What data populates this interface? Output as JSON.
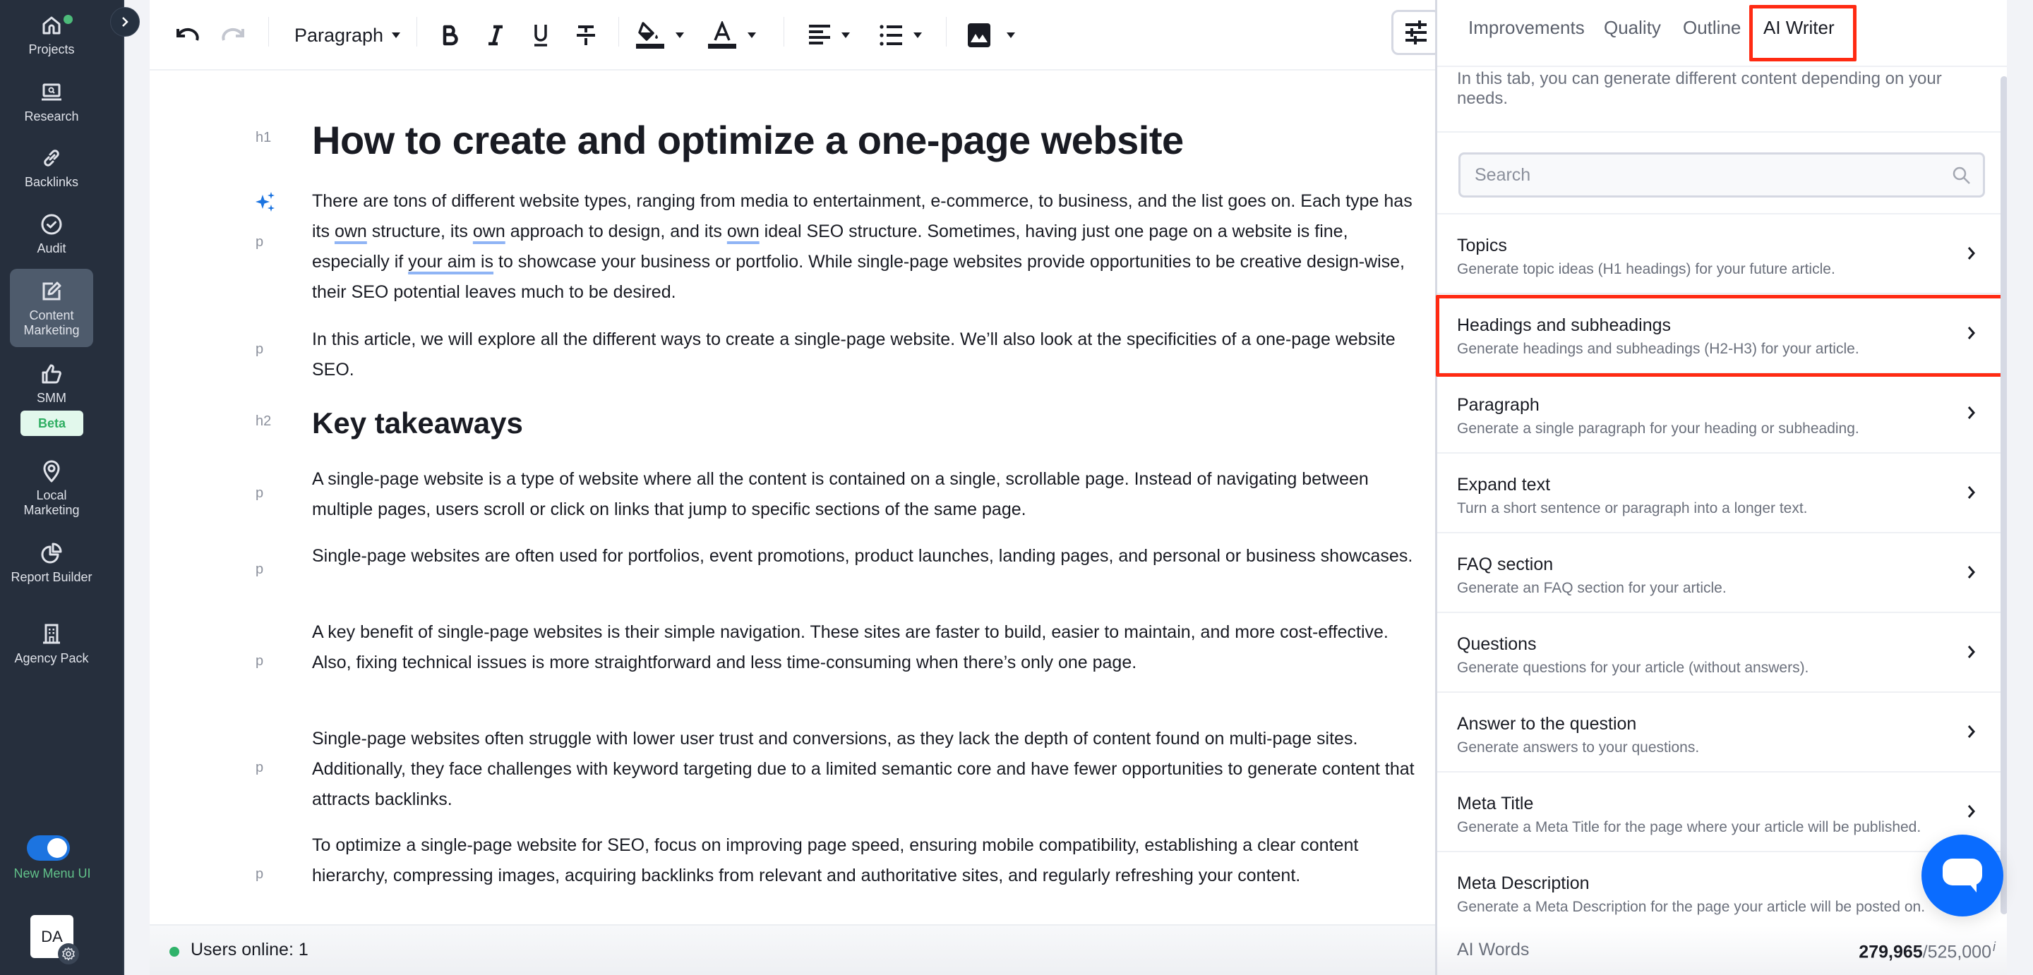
{
  "sidebar": {
    "items": [
      {
        "label": "Projects",
        "icon": "home-icon"
      },
      {
        "label": "Research",
        "icon": "laptop-search-icon"
      },
      {
        "label": "Backlinks",
        "icon": "link-icon"
      },
      {
        "label": "Audit",
        "icon": "check-circle-icon"
      },
      {
        "label": "Content Marketing",
        "icon": "edit-icon",
        "active": true
      },
      {
        "label": "SMM",
        "icon": "thumbs-up-icon",
        "badge": "Beta"
      },
      {
        "label": "Local Marketing",
        "icon": "map-pin-icon"
      },
      {
        "label": "Report Builder",
        "icon": "pie-chart-icon"
      },
      {
        "label": "Agency Pack",
        "icon": "building-icon"
      }
    ],
    "beta_label": "Beta",
    "new_menu_toggle": {
      "label": "New Menu UI",
      "on": true
    },
    "avatar_initials": "DA"
  },
  "toolbar": {
    "block_format": "Paragraph",
    "buttons": [
      "undo",
      "redo",
      "bold",
      "italic",
      "underline",
      "strikethrough",
      "highlight-color",
      "text-color",
      "align",
      "list",
      "image",
      "settings"
    ]
  },
  "document": {
    "h1_tag": "h1",
    "title": "How to create and optimize a one-page website",
    "p_tag": "p",
    "h2_tag": "h2",
    "intro_p1": {
      "a": "There are tons of different website types, ranging from media to entertainment, e-commerce, to business, and the list goes on. Each type has its ",
      "u1": "own",
      "b": " structure, its ",
      "u2": "own",
      "c": " approach to design, and its ",
      "u3": "own",
      "d": " ideal SEO structure. Sometimes, having just one page on a website is fine, especially if ",
      "u4": "your aim is",
      "e": " to showcase your business or portfolio. While single-page websites provide opportunities to be creative design-wise, their SEO potential leaves much to be desired."
    },
    "intro_p2": "In this article, we will explore all the different ways to create a single-page website. We’ll also look at the specificities of a one-page website SEO.",
    "h2": "Key takeaways",
    "paragraphs": [
      "A single-page website is a type of website where all the content is contained on a single, scrollable page. Instead of navigating between multiple pages, users scroll or click on links that jump to specific sections of the same page.",
      "Single-page websites are often used for portfolios, event promotions, product launches, landing pages, and personal or business showcases.",
      "A key benefit of single-page websites is their simple navigation. These sites are faster to build, easier to maintain, and more cost-effective. Also, fixing technical issues is more straightforward and less time-consuming when there’s only one page.",
      "Single-page websites often struggle with lower user trust and conversions, as they lack the depth of content found on multi-page sites. Additionally, they face challenges with keyword targeting due to a limited semantic core and have fewer opportunities to generate content that attracts backlinks.",
      "To optimize a single-page website for SEO, focus on improving page speed, ensuring mobile compatibility, establishing a clear content hierarchy, compressing images, acquiring backlinks from relevant and authoritative sites, and regularly refreshing your content."
    ]
  },
  "status": {
    "users_online": "Users online: 1"
  },
  "panel": {
    "tabs": [
      "Improvements",
      "Quality",
      "Outline",
      "AI Writer"
    ],
    "active_tab": "AI Writer",
    "intro": "In this tab, you can generate different content depending on your needs.",
    "search_placeholder": "Search",
    "search_value": "",
    "items": [
      {
        "title": "Topics",
        "desc": "Generate topic ideas (H1 headings) for your future article."
      },
      {
        "title": "Headings and subheadings",
        "desc": "Generate headings and subheadings (H2-H3) for your article.",
        "highlighted": true
      },
      {
        "title": "Paragraph",
        "desc": "Generate a single paragraph for your heading or subheading."
      },
      {
        "title": "Expand text",
        "desc": "Turn a short sentence or paragraph into a longer text."
      },
      {
        "title": "FAQ section",
        "desc": "Generate an FAQ section for your article."
      },
      {
        "title": "Questions",
        "desc": "Generate questions for your article (without answers)."
      },
      {
        "title": "Answer to the question",
        "desc": "Generate answers to your questions."
      },
      {
        "title": "Meta Title",
        "desc": "Generate a Meta Title for the page where your article will be published."
      },
      {
        "title": "Meta Description",
        "desc": "Generate a Meta Description for the page your article will be posted on."
      }
    ],
    "ai_words_label": "AI Words",
    "ai_words_used": "279,965",
    "ai_words_total": "/525,000",
    "ai_words_info": "i"
  },
  "colors": {
    "sidebar_bg": "#262f3d",
    "accent_blue": "#1c74e0",
    "chat_blue": "#0a6cff",
    "highlight_red": "#ff2a12",
    "beta_green": "#2fae62",
    "online_green": "#2fb26a"
  }
}
